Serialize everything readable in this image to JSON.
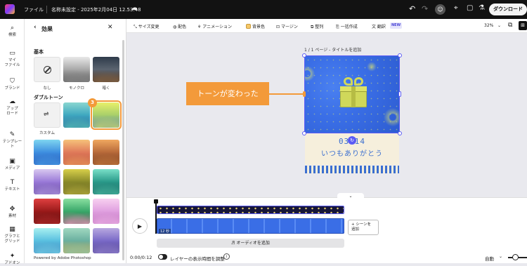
{
  "topbar": {
    "file_menu": "ファイル",
    "doc_title": "名称未設定 - 2025年2月04日 12.53.48",
    "download": "ダウンロード"
  },
  "rail": [
    {
      "icon": "search-icon",
      "glyph": "⌕",
      "label": "検索"
    },
    {
      "icon": "folder-icon",
      "glyph": "▭",
      "label": "マイ\nファイル"
    },
    {
      "icon": "brand-icon",
      "glyph": "⛉",
      "label": "ブランド"
    },
    {
      "icon": "upload-icon",
      "glyph": "☁",
      "label": "アップ\nロード"
    },
    {
      "icon": "template-icon",
      "glyph": "✎",
      "label": "テンプレー\nト"
    },
    {
      "icon": "media-icon",
      "glyph": "▣",
      "label": "メディア"
    },
    {
      "icon": "text-icon",
      "glyph": "T",
      "label": "テキスト"
    },
    {
      "icon": "elements-icon",
      "glyph": "✥",
      "label": "素材"
    },
    {
      "icon": "grid-icon",
      "glyph": "▦",
      "label": "グラフと\nグリッド"
    },
    {
      "icon": "addon-icon",
      "glyph": "✦",
      "label": "アドオン"
    }
  ],
  "panel": {
    "title": "効果",
    "basic_heading": "基本",
    "basic_items": [
      "なし",
      "モノクロ",
      "暗く"
    ],
    "duotone_heading": "ダブルトーン",
    "duotone_first": "カスタム",
    "step_badge": "3",
    "footer": "Powered by Adobe Photoshop"
  },
  "toolbar": {
    "resize": "サイズ変更",
    "color": "配色",
    "animation": "アニメーション",
    "background": "背景色",
    "margin": "マージン",
    "arrange": "整列",
    "bulk": "一括作成",
    "translate": "翻訳",
    "new_badge": "NEW",
    "zoom": "32%"
  },
  "canvas": {
    "page_label": "1 / 1 ページ - タイトルを追加",
    "callout": "トーンが変わった",
    "date_text": "03.14",
    "message": "いつもありがとう"
  },
  "timeline": {
    "time": "0:00/0:12",
    "clip_duration": "12 秒",
    "add_scene": "+ シーンを\n追加",
    "add_audio": "オーディオを追加",
    "layer_timing": "レイヤーの表示時間を調整",
    "auto": "自動"
  },
  "colors": {
    "accent": "#f39a3a",
    "canvas_blue": "#3a6ee6",
    "cream": "#f6efdc",
    "stripe": "#3b6fd0",
    "selection": "#5b5bf5"
  }
}
